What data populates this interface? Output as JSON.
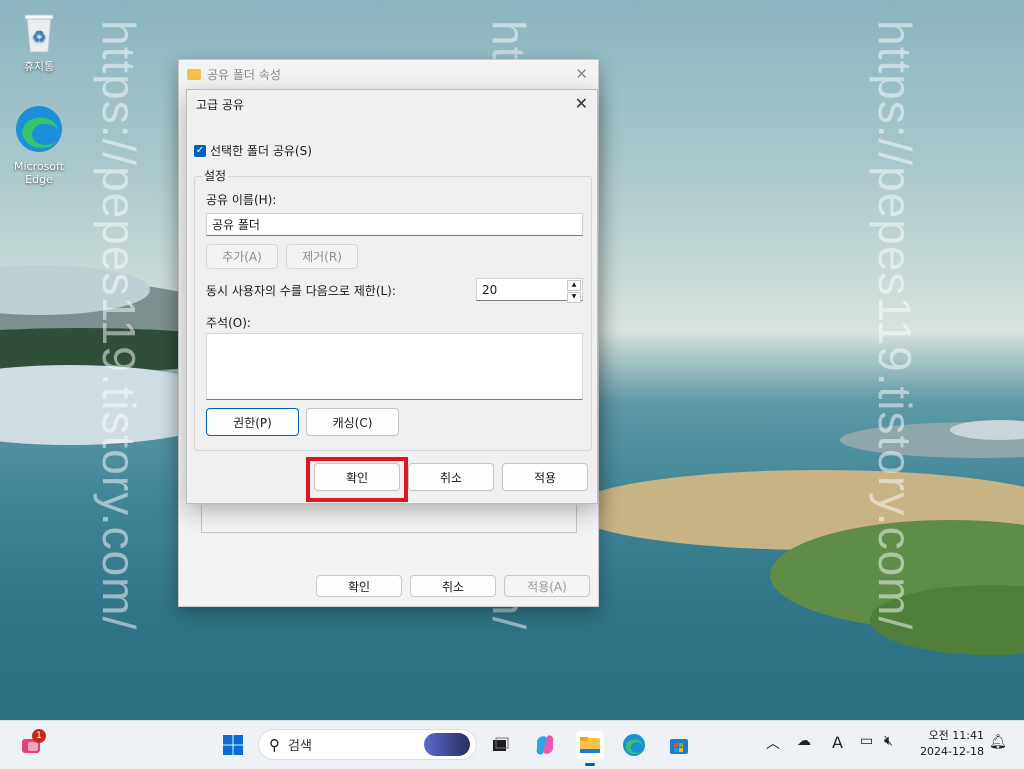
{
  "watermark": "https://pepes119.tistory.com/",
  "desktop": {
    "icons": [
      {
        "label": "휴지통",
        "icon": "recycle-bin-icon"
      },
      {
        "label": "Microsoft Edge",
        "icon": "edge-icon"
      }
    ]
  },
  "properties_window": {
    "title": "공유 폴더 속성",
    "buttons": {
      "ok": "확인",
      "cancel": "취소",
      "apply": "적용(A)"
    }
  },
  "advanced_sharing": {
    "title": "고급 공유",
    "share_checkbox": {
      "label": "선택한 폴더 공유(S)",
      "checked": true
    },
    "settings_group": "설정",
    "share_name_label": "공유 이름(H):",
    "share_name_value": "공유 폴더",
    "add_button": "추가(A)",
    "remove_button": "제거(R)",
    "user_limit_label": "동시 사용자의 수를 다음으로 제한(L):",
    "user_limit_value": "20",
    "comment_label": "주석(O):",
    "comment_value": "",
    "permissions_button": "권한(P)",
    "caching_button": "캐싱(C)",
    "ok_button": "확인",
    "cancel_button": "취소",
    "apply_button": "적용",
    "highlight_color": "#e0141e"
  },
  "taskbar": {
    "search_placeholder": "검색",
    "notification_badge": "1",
    "clock_time": "오전 11:41",
    "clock_date": "2024-12-18",
    "ime_indicator": "A",
    "accent": "#005fb8"
  }
}
